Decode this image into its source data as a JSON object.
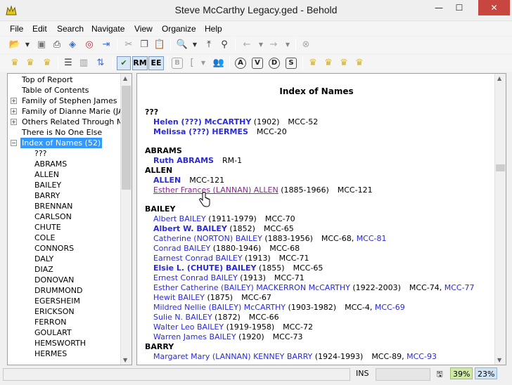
{
  "window": {
    "title": "Steve McCarthy Legacy.ged - Behold",
    "minimize": "—",
    "maximize": "☐",
    "close": "✕"
  },
  "menu": [
    "File",
    "Edit",
    "Search",
    "Navigate",
    "View",
    "Organize",
    "Help"
  ],
  "toolbar2": {
    "rm": "RM",
    "ee": "EE",
    "b": "B",
    "a": "A",
    "v": "V",
    "d": "D",
    "s": "S"
  },
  "tree": {
    "items": [
      {
        "label": "Top of Report",
        "expander": ""
      },
      {
        "label": "Table of Contents",
        "expander": ""
      },
      {
        "label": "Family of Stephen James McC",
        "expander": "+"
      },
      {
        "label": "Family of Dianne Marie (JACK",
        "expander": "+"
      },
      {
        "label": "Others Related Through Marr",
        "expander": "+"
      },
      {
        "label": "There is No One Else",
        "expander": ""
      },
      {
        "label": "Index of Names (52)",
        "expander": "−"
      }
    ],
    "children": [
      "???",
      "ABRAMS",
      "ALLEN",
      "BAILEY",
      "BARRY",
      "BRENNAN",
      "CARLSON",
      "CHUTE",
      "COLE",
      "CONNORS",
      "DALY",
      "DIAZ",
      "DONOVAN",
      "DRUMMOND",
      "EGERSHEIM",
      "ERICKSON",
      "FERRON",
      "GOULART",
      "HEMSWORTH",
      "HERMES"
    ]
  },
  "report": {
    "title": "Index of Names",
    "rows": [
      {
        "kind": "head",
        "text": "???"
      },
      {
        "kind": "entry",
        "name": "Helen (???) McCARTHY",
        "bold": true,
        "dates": " (1902)",
        "refs": "MCC-52",
        "link_ref": ""
      },
      {
        "kind": "entry",
        "name": "Melissa (???) HERMES",
        "bold": true,
        "dates": "",
        "refs": "MCC-20",
        "link_ref": ""
      },
      {
        "kind": "gap"
      },
      {
        "kind": "head",
        "text": "ABRAMS"
      },
      {
        "kind": "entry",
        "name": "Ruth ABRAMS",
        "bold": true,
        "dates": "",
        "refs": "RM-1",
        "link_ref": ""
      },
      {
        "kind": "head",
        "text": "ALLEN"
      },
      {
        "kind": "entry",
        "name": "ALLEN",
        "bold": true,
        "dates": "",
        "refs": "MCC-121",
        "link_ref": ""
      },
      {
        "kind": "entry",
        "name": "Esther Frances (LANNAN) ALLEN",
        "visited": true,
        "dates": " (1885-1966)",
        "refs": "MCC-121",
        "link_ref": ""
      },
      {
        "kind": "gap"
      },
      {
        "kind": "head",
        "text": "BAILEY"
      },
      {
        "kind": "entry",
        "name": "Albert BAILEY",
        "dates": " (1911-1979)",
        "refs": "MCC-70",
        "link_ref": ""
      },
      {
        "kind": "entry",
        "name": "Albert W. BAILEY",
        "bold": true,
        "dates": " (1852)",
        "refs": "MCC-65",
        "link_ref": ""
      },
      {
        "kind": "entry",
        "name": "Catherine (NORTON) BAILEY",
        "dates": " (1883-1956)",
        "refs": "MCC-68, ",
        "link_ref": "MCC-81"
      },
      {
        "kind": "entry",
        "name": "Conrad BAILEY",
        "dates": " (1880-1946)",
        "refs": "MCC-68",
        "link_ref": ""
      },
      {
        "kind": "entry",
        "name": "Earnest Conrad BAILEY",
        "dates": " (1913)",
        "refs": "MCC-71",
        "link_ref": ""
      },
      {
        "kind": "entry",
        "name": "Elsie L. (CHUTE) BAILEY",
        "bold": true,
        "dates": " (1855)",
        "refs": "MCC-65",
        "link_ref": ""
      },
      {
        "kind": "entry",
        "name": "Ernest Conrad BAILEY",
        "dates": " (1913)",
        "refs": "MCC-71",
        "link_ref": ""
      },
      {
        "kind": "entry",
        "name": "Esther Catherine (BAILEY) MACKERRON McCARTHY",
        "dates": " (1922-2003)",
        "refs": "MCC-74, ",
        "link_ref": "MCC-77"
      },
      {
        "kind": "entry",
        "name": "Hewit BAILEY",
        "dates": " (1875)",
        "refs": "MCC-67",
        "link_ref": ""
      },
      {
        "kind": "entry",
        "name": "Mildred Nellie (BAILEY) McCARTHY",
        "dates": " (1903-1982)",
        "refs": "MCC-4, ",
        "link_ref": "MCC-69"
      },
      {
        "kind": "entry",
        "name": "Sulie N. BAILEY",
        "dates": " (1872)",
        "refs": "MCC-66",
        "link_ref": ""
      },
      {
        "kind": "entry",
        "name": "Walter Leo BAILEY",
        "dates": " (1919-1958)",
        "refs": "MCC-72",
        "link_ref": ""
      },
      {
        "kind": "entry",
        "name": "Warren James BAILEY",
        "dates": " (1920)",
        "refs": "MCC-73",
        "link_ref": ""
      },
      {
        "kind": "head",
        "text": "BARRY"
      },
      {
        "kind": "entry",
        "name": "Margaret Mary (LANNAN) KENNEY BARRY",
        "dates": " (1924-1993)",
        "refs": "MCC-89, ",
        "link_ref": "MCC-93"
      }
    ]
  },
  "status": {
    "ins": "INS",
    "pct_green": "39%",
    "pct_blue": "23%"
  }
}
